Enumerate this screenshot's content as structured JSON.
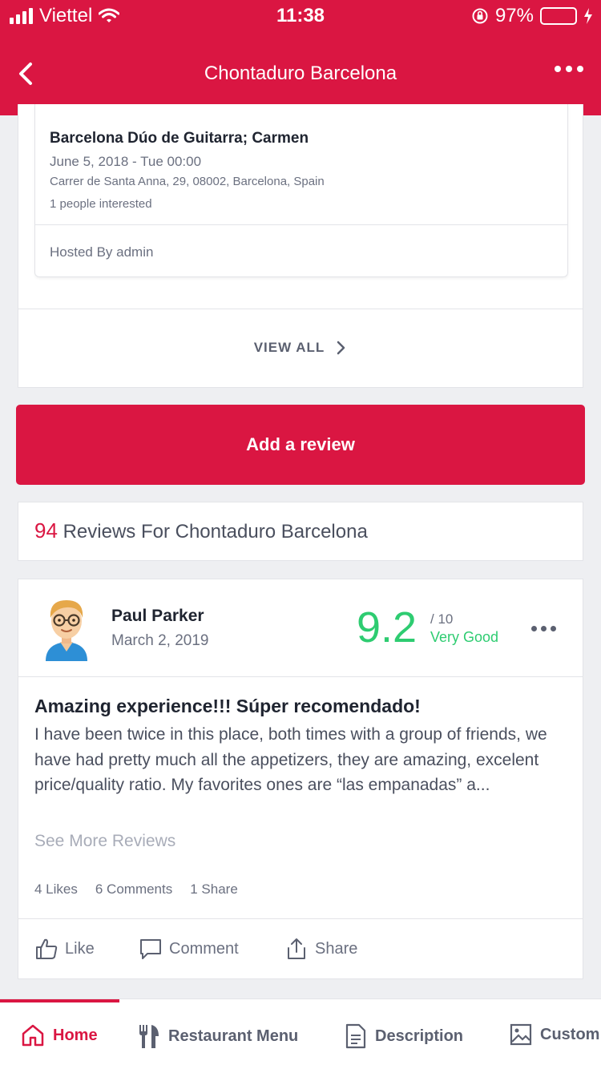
{
  "status_bar": {
    "carrier": "Viettel",
    "time": "11:38",
    "battery_percent": "97%",
    "battery_level": 0.97,
    "battery_color": "#4cd964"
  },
  "header": {
    "title": "Chontaduro Barcelona",
    "back_icon": "chevron-left-icon",
    "more_icon": "more-horizontal-icon",
    "background": "#da1642"
  },
  "event": {
    "title": "Barcelona Dúo de Guitarra; Carmen",
    "date": "June 5, 2018 - Tue 00:00",
    "address": "Carrer de Santa Anna, 29, 08002, Barcelona, Spain",
    "interested": "1 people interested",
    "hosted_by": "Hosted By admin"
  },
  "view_all": {
    "label": "VIEW ALL",
    "icon": "chevron-right-icon"
  },
  "add_review": {
    "label": "Add a review"
  },
  "reviews": {
    "count": "94",
    "heading": "Reviews For Chontaduro Barcelona",
    "items": [
      {
        "author": "Paul Parker",
        "date": "March 2, 2019",
        "score": "9.2",
        "out_of": "/ 10",
        "verdict": "Very Good",
        "title": "Amazing experience!!! Súper recomendado!",
        "body": "I have been twice in this place, both times with a group of friends, we have had pretty much all the appetizers, they are amazing, excelent price/quality ratio. My favorites ones are “las empanadas” a...",
        "see_more": "See More Reviews",
        "likes": "4 Likes",
        "comments": "6 Comments",
        "shares": "1 Share",
        "actions": {
          "like": "Like",
          "comment": "Comment",
          "share": "Share"
        }
      }
    ]
  },
  "tabs": [
    {
      "label": "Home",
      "icon": "home-icon",
      "active": true
    },
    {
      "label": "Restaurant Menu",
      "icon": "fork-knife-icon",
      "active": false
    },
    {
      "label": "Description",
      "icon": "document-icon",
      "active": false
    },
    {
      "label": "Custom",
      "icon": "image-icon",
      "active": false
    }
  ],
  "colors": {
    "accent": "#da1642",
    "score": "#2ecc71"
  }
}
